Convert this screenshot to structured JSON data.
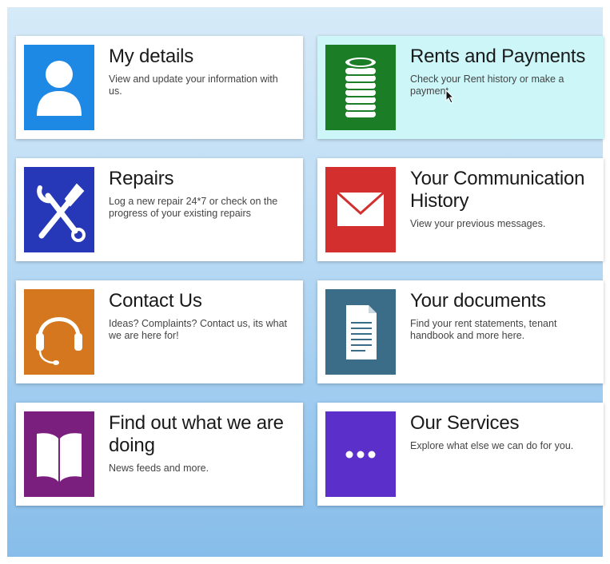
{
  "tiles": [
    {
      "title": "My details",
      "description": "View and update your information with us.",
      "icon": "user-icon",
      "color": "#1e88e5",
      "highlight": false
    },
    {
      "title": "Rents and Payments",
      "description": "Check your Rent history or make a payment",
      "icon": "coins-icon",
      "color": "#1b7d26",
      "highlight": true
    },
    {
      "title": "Repairs",
      "description": "Log a new repair 24*7 or check on the progress of your existing repairs",
      "icon": "tools-icon",
      "color": "#2638b8",
      "highlight": false
    },
    {
      "title": "Your Communication History",
      "description": "View your previous messages.",
      "icon": "envelope-icon",
      "color": "#d32f2f",
      "highlight": false
    },
    {
      "title": "Contact Us",
      "description": "Ideas? Complaints? Contact us, its what we are here for!",
      "icon": "headset-icon",
      "color": "#d4771e",
      "highlight": false
    },
    {
      "title": "Your documents",
      "description": "Find your rent statements, tenant handbook and more here.",
      "icon": "document-icon",
      "color": "#3b6c88",
      "highlight": false
    },
    {
      "title": "Find out what we are doing",
      "description": "News feeds and more.",
      "icon": "book-icon",
      "color": "#7a1f7e",
      "highlight": false
    },
    {
      "title": "Our Services",
      "description": "Explore what else we can do for you.",
      "icon": "more-dots-icon",
      "color": "#5b2fc9",
      "highlight": false
    }
  ],
  "colors": {
    "background_top": "#d6eaf8",
    "background_bottom": "#87bdea",
    "highlight_tile": "#ccf6f8"
  }
}
